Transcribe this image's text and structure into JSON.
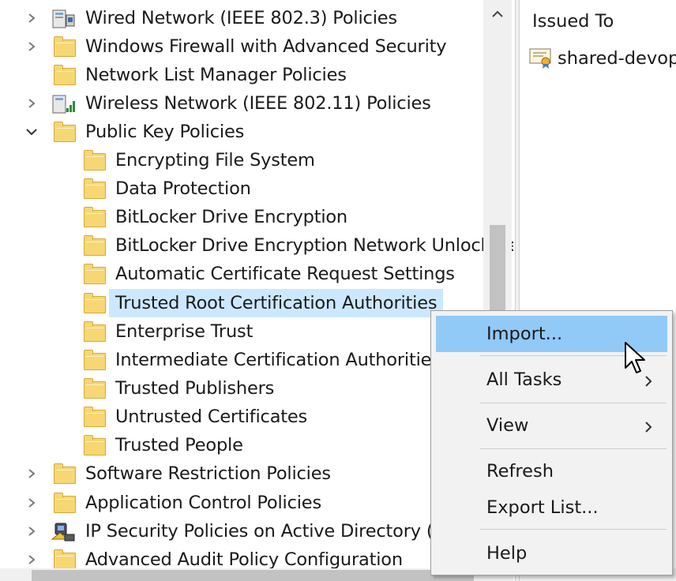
{
  "tree": {
    "items": [
      {
        "label": "Wired Network (IEEE 802.3) Policies",
        "arrow": "collapsed",
        "icon": "network-policy-icon"
      },
      {
        "label": "Windows Firewall with Advanced Security",
        "arrow": "collapsed",
        "icon": "folder-icon"
      },
      {
        "label": "Network List Manager Policies",
        "arrow": "none",
        "icon": "folder-icon"
      },
      {
        "label": "Wireless Network (IEEE 802.11) Policies",
        "arrow": "collapsed",
        "icon": "wireless-policy-icon"
      },
      {
        "label": "Public Key Policies",
        "arrow": "expanded",
        "icon": "folder-icon"
      },
      {
        "label": "Encrypting File System",
        "arrow": "none",
        "icon": "folder-icon"
      },
      {
        "label": "Data Protection",
        "arrow": "none",
        "icon": "folder-icon"
      },
      {
        "label": "BitLocker Drive Encryption",
        "arrow": "none",
        "icon": "folder-icon"
      },
      {
        "label": "BitLocker Drive Encryption Network Unlock Certificate",
        "arrow": "none",
        "icon": "folder-icon"
      },
      {
        "label": "Automatic Certificate Request Settings",
        "arrow": "none",
        "icon": "folder-icon"
      },
      {
        "label": "Trusted Root Certification Authorities",
        "arrow": "none",
        "icon": "folder-icon",
        "selected": true
      },
      {
        "label": "Enterprise Trust",
        "arrow": "none",
        "icon": "folder-icon"
      },
      {
        "label": "Intermediate Certification Authorities",
        "arrow": "none",
        "icon": "folder-icon"
      },
      {
        "label": "Trusted Publishers",
        "arrow": "none",
        "icon": "folder-icon"
      },
      {
        "label": "Untrusted Certificates",
        "arrow": "none",
        "icon": "folder-icon"
      },
      {
        "label": "Trusted People",
        "arrow": "none",
        "icon": "folder-icon"
      },
      {
        "label": "Software Restriction Policies",
        "arrow": "collapsed",
        "icon": "folder-icon"
      },
      {
        "label": "Application Control Policies",
        "arrow": "collapsed",
        "icon": "folder-icon"
      },
      {
        "label": "IP Security Policies on Active Directory (B",
        "arrow": "collapsed",
        "icon": "ip-security-icon"
      },
      {
        "label": "Advanced Audit Policy Configuration",
        "arrow": "collapsed",
        "icon": "folder-icon"
      }
    ]
  },
  "details": {
    "column_header": "Issued To",
    "rows": [
      {
        "label": "shared-devops",
        "icon": "certificate-icon"
      }
    ]
  },
  "context_menu": {
    "items": [
      {
        "label": "Import...",
        "highlighted": true
      },
      {
        "label": "All Tasks",
        "submenu": true
      },
      {
        "label": "View",
        "submenu": true
      },
      {
        "label": "Refresh"
      },
      {
        "label": "Export List..."
      },
      {
        "label": "Help"
      }
    ]
  },
  "colors": {
    "selection": "#cce8ff",
    "menu_highlight": "#91c9f7",
    "folder_fill": "#f6d774",
    "menu_background": "#f2f2f2"
  }
}
